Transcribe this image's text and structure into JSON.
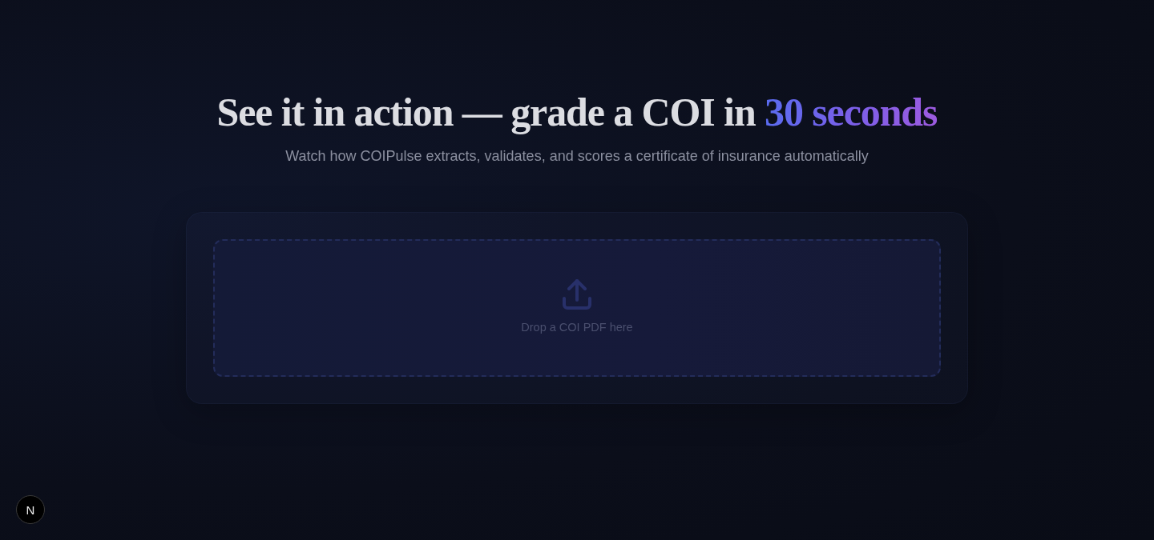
{
  "heading": {
    "text": "See it in action — grade a COI in",
    "highlight": "30 seconds"
  },
  "subtitle": "Watch how COIPulse extracts, validates, and scores a certificate of insurance automatically",
  "upload": {
    "prompt": "Drop a COI PDF here"
  },
  "dev_indicator": {
    "label": "N"
  }
}
